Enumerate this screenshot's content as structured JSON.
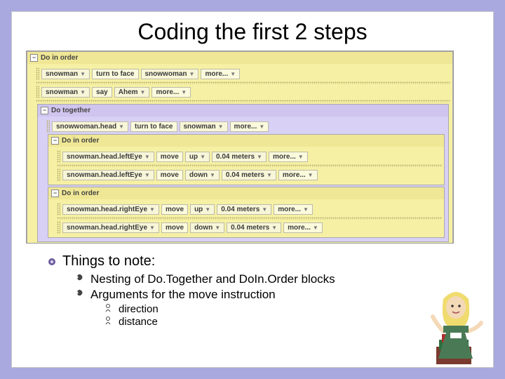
{
  "title": "Coding the first 2 steps",
  "code": {
    "outer": {
      "label": "Do in order"
    },
    "row1": {
      "obj": "snowman",
      "method": "turn to face",
      "arg": "snowwoman",
      "more": "more..."
    },
    "row2": {
      "obj": "snowman",
      "method": "say",
      "arg": "Ahem",
      "more": "more..."
    },
    "together": {
      "label": "Do together"
    },
    "row3": {
      "obj": "snowwoman.head",
      "method": "turn to face",
      "arg": "snowman",
      "more": "more..."
    },
    "inorderA": {
      "label": "Do in order"
    },
    "row4": {
      "obj": "snowman.head.leftEye",
      "method": "move",
      "dir": "up",
      "dist": "0.04 meters",
      "more": "more..."
    },
    "row5": {
      "obj": "snowman.head.leftEye",
      "method": "move",
      "dir": "down",
      "dist": "0.04 meters",
      "more": "more..."
    },
    "inorderB": {
      "label": "Do in order"
    },
    "row6": {
      "obj": "snowman.head.rightEye",
      "method": "move",
      "dir": "up",
      "dist": "0.04 meters",
      "more": "more..."
    },
    "row7": {
      "obj": "snowman.head.rightEye",
      "method": "move",
      "dir": "down",
      "dist": "0.04 meters",
      "more": "more..."
    }
  },
  "bullets": {
    "l1": "Things to note:",
    "l2a": "Nesting of Do.Together and DoIn.Order blocks",
    "l2b": "Arguments for the move instruction",
    "l3a": "direction",
    "l3b": "distance"
  }
}
